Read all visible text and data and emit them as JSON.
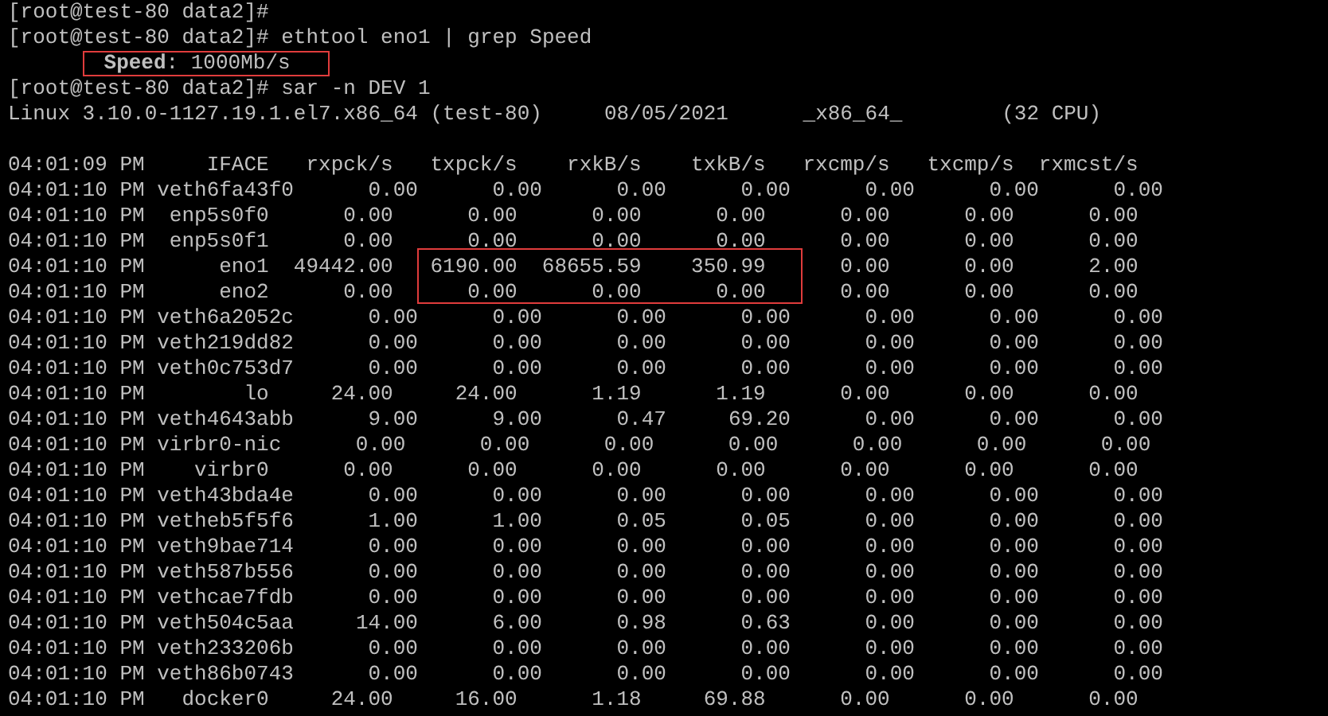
{
  "terminal": {
    "lines_before": [
      {
        "kind": "prompt",
        "text": "[root@test-80 data2]#"
      },
      {
        "kind": "prompt",
        "text": "[root@test-80 data2]# ethtool eno1 | grep Speed"
      },
      {
        "kind": "output",
        "text": "**Speed**: 1000Mb/s",
        "highlighted": true
      },
      {
        "kind": "prompt",
        "text": "[root@test-80 data2]# sar -n DEV 1"
      },
      {
        "kind": "output",
        "text": "Linux 3.10.0-1127.19.1.el7.x86_64 (test-80)\t08/05/2021\t_x86_64_\t(32 CPU)",
        "highlighted": false
      }
    ],
    "table": {
      "header": {
        "time": "04:01:09 PM",
        "columns": [
          "IFACE",
          "rxpck/s",
          "txpck/s",
          "rxkB/s",
          "txkB/s",
          "rxcmp/s",
          "txcmp/s",
          "rxmcst/s"
        ]
      },
      "rows": [
        {
          "time": "04:01:10 PM",
          "cells": [
            "veth6fa43f0",
            "0.00",
            "0.00",
            "0.00",
            "0.00",
            "0.00",
            "0.00",
            "0.00"
          ],
          "highlighted": false
        },
        {
          "time": "04:01:10 PM",
          "cells": [
            "enp5s0f0",
            "0.00",
            "0.00",
            "0.00",
            "0.00",
            "0.00",
            "0.00",
            "0.00"
          ],
          "highlighted": false
        },
        {
          "time": "04:01:10 PM",
          "cells": [
            "enp5s0f1",
            "0.00",
            "0.00",
            "0.00",
            "0.00",
            "0.00",
            "0.00",
            "0.00"
          ],
          "highlighted": false
        },
        {
          "time": "04:01:10 PM",
          "cells": [
            "eno1",
            "49442.00",
            "6190.00",
            "68655.59",
            "350.99",
            "0.00",
            "0.00",
            "2.00"
          ],
          "highlighted": true
        },
        {
          "time": "04:01:10 PM",
          "cells": [
            "eno2",
            "0.00",
            "0.00",
            "0.00",
            "0.00",
            "0.00",
            "0.00",
            "0.00"
          ],
          "highlighted": true
        },
        {
          "time": "04:01:10 PM",
          "cells": [
            "veth6a2052c",
            "0.00",
            "0.00",
            "0.00",
            "0.00",
            "0.00",
            "0.00",
            "0.00"
          ],
          "highlighted": false
        },
        {
          "time": "04:01:10 PM",
          "cells": [
            "veth219dd82",
            "0.00",
            "0.00",
            "0.00",
            "0.00",
            "0.00",
            "0.00",
            "0.00"
          ],
          "highlighted": false
        },
        {
          "time": "04:01:10 PM",
          "cells": [
            "veth0c753d7",
            "0.00",
            "0.00",
            "0.00",
            "0.00",
            "0.00",
            "0.00",
            "0.00"
          ],
          "highlighted": false
        },
        {
          "time": "04:01:10 PM",
          "cells": [
            "lo",
            "24.00",
            "24.00",
            "1.19",
            "1.19",
            "0.00",
            "0.00",
            "0.00"
          ],
          "highlighted": false
        },
        {
          "time": "04:01:10 PM",
          "cells": [
            "veth4643abb",
            "9.00",
            "9.00",
            "0.47",
            "69.20",
            "0.00",
            "0.00",
            "0.00"
          ],
          "highlighted": false
        },
        {
          "time": "04:01:10 PM",
          "cells": [
            "virbr0-nic",
            "0.00",
            "0.00",
            "0.00",
            "0.00",
            "0.00",
            "0.00",
            "0.00"
          ],
          "highlighted": false
        },
        {
          "time": "04:01:10 PM",
          "cells": [
            "virbr0",
            "0.00",
            "0.00",
            "0.00",
            "0.00",
            "0.00",
            "0.00",
            "0.00"
          ],
          "highlighted": false
        },
        {
          "time": "04:01:10 PM",
          "cells": [
            "veth43bda4e",
            "0.00",
            "0.00",
            "0.00",
            "0.00",
            "0.00",
            "0.00",
            "0.00"
          ],
          "highlighted": false
        },
        {
          "time": "04:01:10 PM",
          "cells": [
            "vetheb5f5f6",
            "1.00",
            "1.00",
            "0.05",
            "0.05",
            "0.00",
            "0.00",
            "0.00"
          ],
          "highlighted": false
        },
        {
          "time": "04:01:10 PM",
          "cells": [
            "veth9bae714",
            "0.00",
            "0.00",
            "0.00",
            "0.00",
            "0.00",
            "0.00",
            "0.00"
          ],
          "highlighted": false
        },
        {
          "time": "04:01:10 PM",
          "cells": [
            "veth587b556",
            "0.00",
            "0.00",
            "0.00",
            "0.00",
            "0.00",
            "0.00",
            "0.00"
          ],
          "highlighted": false
        },
        {
          "time": "04:01:10 PM",
          "cells": [
            "vethcae7fdb",
            "0.00",
            "0.00",
            "0.00",
            "0.00",
            "0.00",
            "0.00",
            "0.00"
          ],
          "highlighted": false
        },
        {
          "time": "04:01:10 PM",
          "cells": [
            "veth504c5aa",
            "14.00",
            "6.00",
            "0.98",
            "0.63",
            "0.00",
            "0.00",
            "0.00"
          ],
          "highlighted": false
        },
        {
          "time": "04:01:10 PM",
          "cells": [
            "veth233206b",
            "0.00",
            "0.00",
            "0.00",
            "0.00",
            "0.00",
            "0.00",
            "0.00"
          ],
          "highlighted": false
        },
        {
          "time": "04:01:10 PM",
          "cells": [
            "veth86b0743",
            "0.00",
            "0.00",
            "0.00",
            "0.00",
            "0.00",
            "0.00",
            "0.00"
          ],
          "highlighted": false
        },
        {
          "time": "04:01:10 PM",
          "cells": [
            "docker0",
            "24.00",
            "16.00",
            "1.18",
            "69.88",
            "0.00",
            "0.00",
            "0.00"
          ],
          "highlighted": false
        }
      ]
    }
  }
}
